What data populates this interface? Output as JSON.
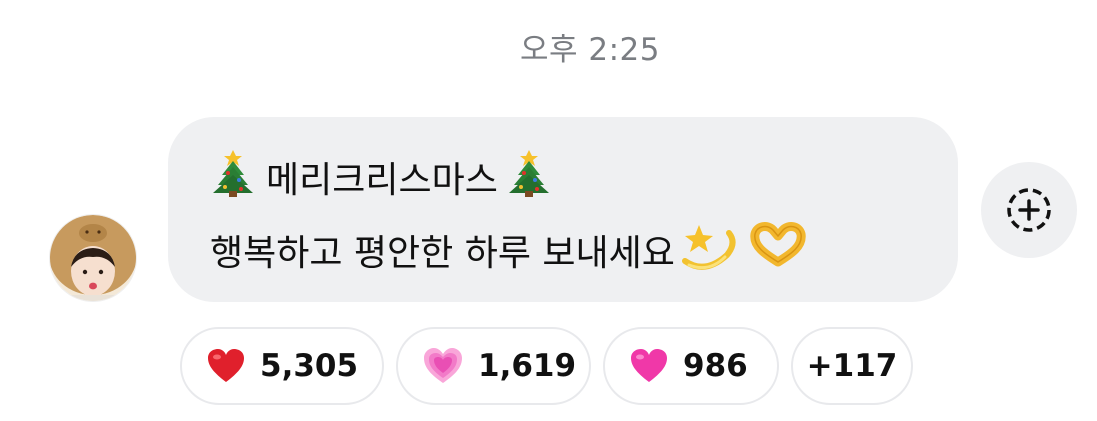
{
  "timestamp": "오후 2:25",
  "message": {
    "line1_text": "메리크리스마스",
    "line2_text": "행복하고 평안한 하루 보내세요",
    "line1_emojis": [
      "christmas-tree-icon",
      "christmas-tree-icon"
    ],
    "line2_emojis": [
      "dizzy-icon",
      "heart-hands-icon"
    ]
  },
  "reactions": [
    {
      "icon": "red-heart-icon",
      "count": "5,305",
      "color": "#e0202c"
    },
    {
      "icon": "growing-heart-icon",
      "count": "1,619",
      "color": "#f27ac8"
    },
    {
      "icon": "pink-heart-icon",
      "count": "986",
      "color": "#f038a8"
    },
    {
      "icon": "more-reactions",
      "count": "+117"
    }
  ],
  "colors": {
    "bubble_bg": "#eff0f2",
    "timestamp": "#7a7d82",
    "pill_border": "#e8e9ec"
  }
}
